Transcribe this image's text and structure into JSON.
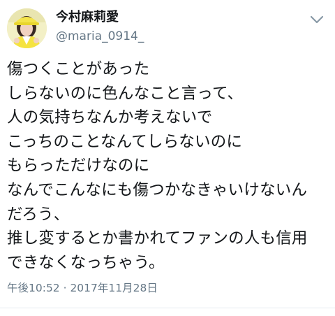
{
  "tweet": {
    "author": {
      "display_name": "今村麻莉愛",
      "handle": "@maria_0914_"
    },
    "icons": {
      "avatar": "profile-photo",
      "menu": "chevron-down-icon"
    },
    "body_lines": [
      "傷つくことがあった",
      "しらないのに色んなこと言って、",
      "人の気持ちなんか考えないで",
      "こっちのことなんてしらないのに",
      "もらっただけなのに",
      "なんでこんなにも傷つかなきゃいけないん",
      "だろう、",
      "推し変するとか書かれてファンの人も信用",
      "できなくなっちゃう。"
    ],
    "timestamp": "午後10:52 · 2017年11月28日"
  },
  "colors": {
    "text_primary": "#14171a",
    "text_secondary": "#657786",
    "divider": "#e6ecf0",
    "background": "#ffffff"
  }
}
